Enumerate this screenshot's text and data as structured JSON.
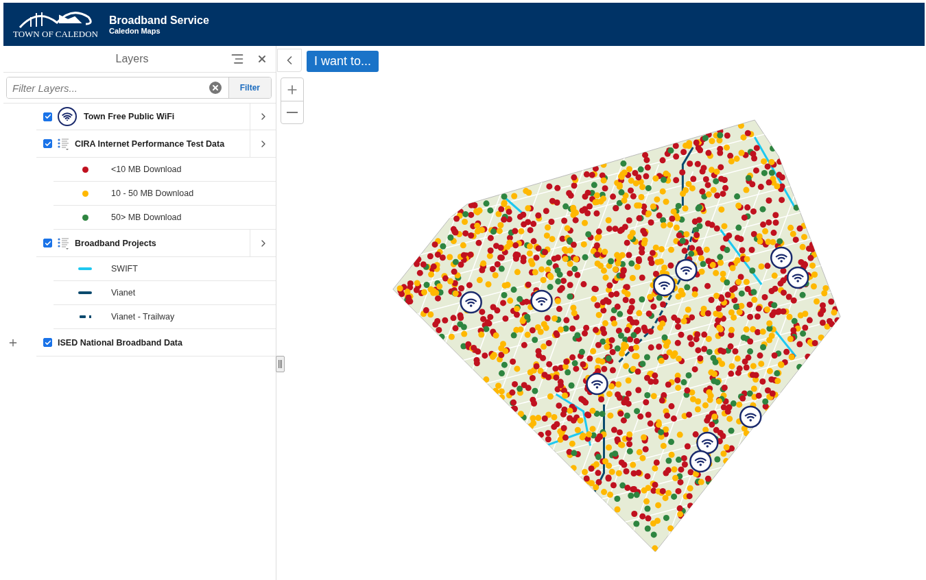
{
  "header": {
    "logo_text": "TOWN OF CALEDON",
    "title": "Broadband Service",
    "subtitle": "Caledon Maps"
  },
  "panel": {
    "title": "Layers",
    "filter": {
      "placeholder": "Filter Layers...",
      "button": "Filter"
    },
    "layers": [
      {
        "kind": "wifi",
        "label": "Town Free Public WiFi",
        "checked": true
      },
      {
        "kind": "legend",
        "label": "CIRA Internet Performance Test Data",
        "checked": true,
        "legend": [
          {
            "kind": "dot",
            "label": "<10 MB Download",
            "color": "#c0111f"
          },
          {
            "kind": "dot",
            "label": "10 - 50 MB Download",
            "color": "#ffb800"
          },
          {
            "kind": "dot",
            "label": "50> MB Download",
            "color": "#2e8540"
          }
        ]
      },
      {
        "kind": "legend",
        "label": "Broadband Projects",
        "checked": true,
        "legend": [
          {
            "kind": "line",
            "label": "SWIFT",
            "color": "#1ec8f0"
          },
          {
            "kind": "line",
            "label": "Vianet",
            "color": "#0b4a6e"
          },
          {
            "kind": "dash",
            "label": "Vianet - Trailway",
            "color": "#0b4a6e"
          }
        ]
      },
      {
        "kind": "group",
        "label": "ISED National Broadband Data",
        "checked": true
      }
    ]
  },
  "map": {
    "action_button": "I want to..."
  }
}
